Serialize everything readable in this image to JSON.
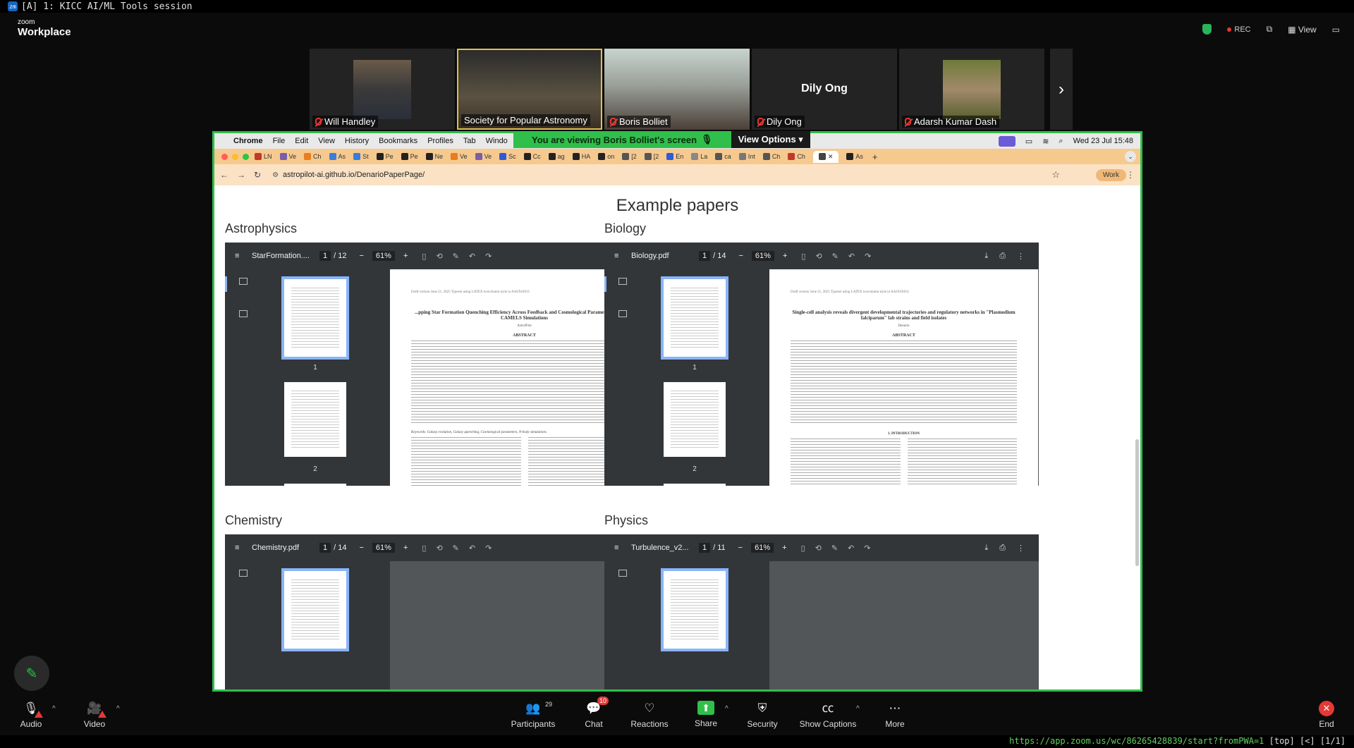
{
  "terminal": {
    "badge": "zm",
    "title": "[A] 1: KICC AI/ML Tools session"
  },
  "zoom": {
    "logo_small": "zoom",
    "logo_big": "Workplace",
    "rec": "REC",
    "view": "View"
  },
  "participants_strip": [
    {
      "name": "Will Handley",
      "muted": true
    },
    {
      "name": "Society for Popular Astronomy",
      "muted": false,
      "active": true
    },
    {
      "name": "Boris Bolliet",
      "muted": true
    },
    {
      "name": "Dily Ong",
      "muted": true,
      "big_name": "Dily Ong"
    },
    {
      "name": "Adarsh Kumar Dash",
      "muted": true
    }
  ],
  "banner": {
    "text": "You are viewing  Boris Bolliet's screen",
    "view_options": "View Options"
  },
  "mac_menu": {
    "app": "Chrome",
    "items": [
      "File",
      "Edit",
      "View",
      "History",
      "Bookmarks",
      "Profiles",
      "Tab",
      "Windo"
    ],
    "clock": "Wed 23 Jul  15:48"
  },
  "tabs": [
    "LN",
    "Ve",
    "Ch",
    "As",
    "St",
    "Pe",
    "Pe",
    "Ne",
    "Ve",
    "Ve",
    "Sc",
    "Cc",
    "ag",
    "HA",
    "on",
    "[2",
    "[2",
    "En",
    "La",
    "ca",
    "Int",
    "Ch",
    "Ch"
  ],
  "active_tab": "",
  "url": "astropilot-ai.github.io/DenarioPaperPage/",
  "profile": "Work",
  "page": {
    "heading": "Example papers",
    "sections": [
      {
        "title": "Astrophysics",
        "file": "StarFormation....",
        "page": "1",
        "pages": "/ 12",
        "zoom": "61%",
        "paper_title": "...pping Star Formation Quenching Efficiency Across Feedback and Cosmological Parameter Space with CAMELS Simulations",
        "paper_author": "AstroPilot",
        "thumbs": [
          "1",
          "2"
        ]
      },
      {
        "title": "Biology",
        "file": "Biology.pdf",
        "page": "1",
        "pages": "/ 14",
        "zoom": "61%",
        "paper_title": "Single-cell analysis reveals divergent developmental trajectories and regulatory networks in \"Plasmodium falciparum\" lab strains and field isolates",
        "paper_author": "Denario",
        "thumbs": [
          "1",
          "2"
        ]
      },
      {
        "title": "Chemistry",
        "file": "Chemistry.pdf",
        "page": "1",
        "pages": "/ 14",
        "zoom": "61%"
      },
      {
        "title": "Physics",
        "file": "Turbulence_v2...",
        "page": "1",
        "pages": "/ 11",
        "zoom": "61%"
      }
    ],
    "paper_meta": "Draft version June 21, 2025 Typeset using LATEX twocolumn style in AASTeX631",
    "abstract_label": "ABSTRACT",
    "keywords": "Keywords: Galaxy evolution, Galaxy quenching, Cosmological parameters, N-body simulations",
    "intro_label": "1. INTRODUCTION"
  },
  "toolbar": {
    "audio": "Audio",
    "video": "Video",
    "participants": "Participants",
    "participants_count": "29",
    "chat": "Chat",
    "chat_badge": "10",
    "reactions": "Reactions",
    "share": "Share",
    "security": "Security",
    "captions": "Show Captions",
    "more": "More",
    "end": "End"
  },
  "status_url": "https://app.zoom.us/wc/86265428839/start?fromPWA=1",
  "status_suffix": " [top] [<] [1/1]",
  "colors": {
    "share_border": "#2fbf4a",
    "tab_bar": "#f6c98f",
    "address_bar": "#fbe2c4",
    "viewer_bg": "#323639"
  }
}
